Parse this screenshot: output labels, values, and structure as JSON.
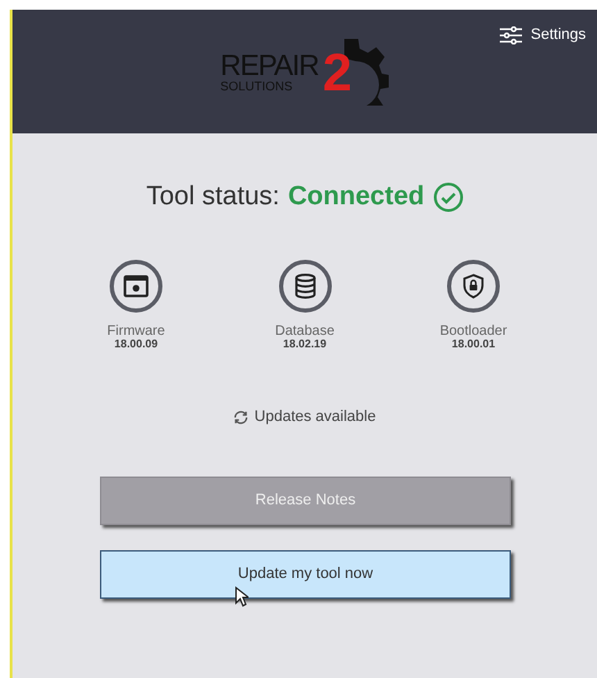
{
  "header": {
    "logo": {
      "word_1": "REPAIR",
      "word_2": "SOLUTIONS",
      "numeral": "2"
    },
    "settings": "Settings"
  },
  "status": {
    "label": "Tool status:",
    "value": "Connected",
    "connected": true
  },
  "components": [
    {
      "kind": "firmware",
      "name": "Firmware",
      "version": "18.00.09"
    },
    {
      "kind": "database",
      "name": "Database",
      "version": "18.02.19"
    },
    {
      "kind": "bootloader",
      "name": "Bootloader",
      "version": "18.00.01"
    }
  ],
  "updates": "Updates available",
  "buttons": [
    {
      "label": "Release Notes",
      "kind": "secondary",
      "hovered": false
    },
    {
      "label": "Update my tool now",
      "kind": "primary",
      "hovered": true
    }
  ]
}
